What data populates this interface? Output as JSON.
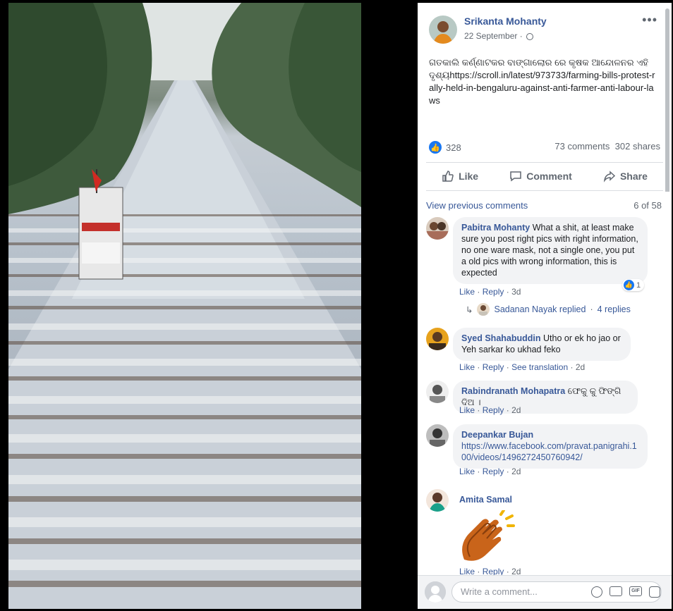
{
  "post": {
    "author": "Srikanta Mohanty",
    "date": "22 September",
    "menu_icon": "more-dots-icon",
    "text": "ଗତକାଲି କର୍ଣ୍ଣାଟକର ବାଙ୍ଗାଲୋର ରେ କୃଷକ ଆନ୍ଦୋଳନର ଏହି ଦୃଶ୍ୟhttps://scroll.in/latest/973733/farming-bills-protest-rally-held-in-bengaluru-against-anti-farmer-anti-labour-laws",
    "like_count": "328",
    "comments_count": "73 comments",
    "shares_count": "302 shares"
  },
  "actions": {
    "like": "Like",
    "comment": "Comment",
    "share": "Share"
  },
  "comments_section": {
    "view_previous": "View previous comments",
    "count": "6 of 58"
  },
  "comments": [
    {
      "name": "Pabitra Mohanty",
      "text": "What a shit, at least make sure you post right pics with right information, no one ware mask, not a single one, you put a old pics with wrong information, this is expected",
      "like": "Like",
      "reply": "Reply",
      "time": "3d",
      "reaction_count": "1"
    },
    {
      "name": "Syed Shahabuddin",
      "text": "Utho or ek ho jao or Yeh sarkar ko ukhad feko",
      "like": "Like",
      "reply": "Reply",
      "translate": "See translation",
      "time": "2d"
    },
    {
      "name": "Rabindranath Mohapatra",
      "text": "ଫେକୁ କୁ ଫିଙ୍ଗି ଦିଅ ।",
      "like": "Like",
      "reply": "Reply",
      "time": "2d"
    },
    {
      "name": "Deepankar Bujan",
      "text": "https://www.facebook.com/pravat.panigrahi.100/videos/1496272450760942/",
      "like": "Like",
      "reply": "Reply",
      "time": "2d"
    },
    {
      "name": "Amita Samal",
      "sticker": "clapping-hands-icon",
      "like": "Like",
      "reply": "Reply",
      "time": "2d"
    }
  ],
  "reply_thread": {
    "text": "Sadanan Nayak replied",
    "count": "4 replies"
  },
  "composer": {
    "placeholder": "Write a comment..."
  },
  "colors": {
    "link_blue": "#385898",
    "like_blue": "#1877f2",
    "bubble_gray": "#f2f3f5",
    "meta_gray": "#606770",
    "clap_orange": "#e07b1a"
  }
}
